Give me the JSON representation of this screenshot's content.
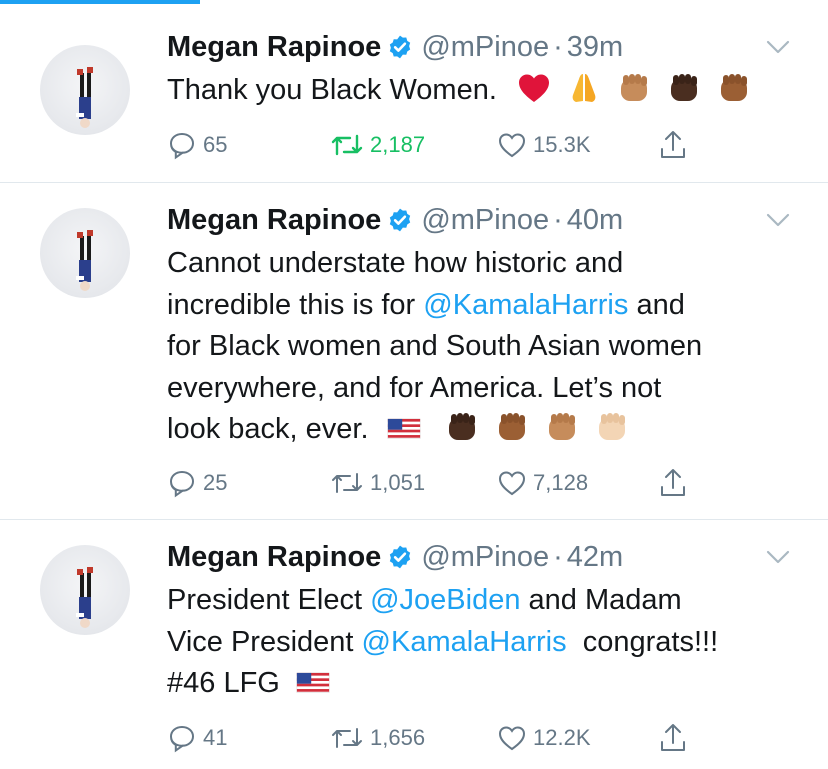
{
  "tweets": [
    {
      "name": "Megan Rapinoe",
      "handle": "@mPinoe",
      "separator": "·",
      "time": "39m",
      "text_segments": [
        {
          "text": "Thank you Black Women.",
          "type": "text"
        }
      ],
      "emojis": [
        "red-heart-emoji",
        "folded-hands-emoji",
        "raised-fist-medium-emoji",
        "raised-fist-dark-emoji",
        "raised-fist-medium-dark-emoji"
      ],
      "replies": "65",
      "retweets": "2,187",
      "likes": "15.3K",
      "retweeted": true
    },
    {
      "name": "Megan Rapinoe",
      "handle": "@mPinoe",
      "separator": "·",
      "time": "40m",
      "lines": [
        [
          {
            "text": "Cannot understate how historic and",
            "type": "text"
          }
        ],
        [
          {
            "text": "incredible this is for ",
            "type": "text"
          },
          {
            "text": "@KamalaHarris",
            "type": "mention"
          },
          {
            "text": " and",
            "type": "text"
          }
        ],
        [
          {
            "text": "for Black women and South Asian women",
            "type": "text"
          }
        ],
        [
          {
            "text": "everywhere, and for America. Let’s not",
            "type": "text"
          }
        ],
        [
          {
            "text": "look back, ever.",
            "type": "text"
          }
        ]
      ],
      "emojis": [
        "us-flag-emoji",
        "raised-fist-dark-emoji",
        "raised-fist-medium-dark-emoji",
        "raised-fist-medium-emoji",
        "raised-fist-light-emoji"
      ],
      "replies": "25",
      "retweets": "1,051",
      "likes": "7,128",
      "retweeted": false
    },
    {
      "name": "Megan Rapinoe",
      "handle": "@mPinoe",
      "separator": "·",
      "time": "42m",
      "lines": [
        [
          {
            "text": "President Elect ",
            "type": "text"
          },
          {
            "text": "@JoeBiden",
            "type": "mention"
          },
          {
            "text": " and Madam",
            "type": "text"
          }
        ],
        [
          {
            "text": "Vice President ",
            "type": "text"
          },
          {
            "text": "@KamalaHarris",
            "type": "mention"
          },
          {
            "text": "  congrats!!!",
            "type": "text"
          }
        ],
        [
          {
            "text": "#46 LFG",
            "type": "text"
          }
        ]
      ],
      "emojis": [
        "us-flag-emoji"
      ],
      "replies": "41",
      "retweets": "1,656",
      "likes": "12.2K",
      "retweeted": false
    }
  ],
  "colors": {
    "accent": "#1da1f2",
    "retweet_active": "#17bf63",
    "secondary_text": "#657786",
    "divider": "#e1e8ed"
  }
}
